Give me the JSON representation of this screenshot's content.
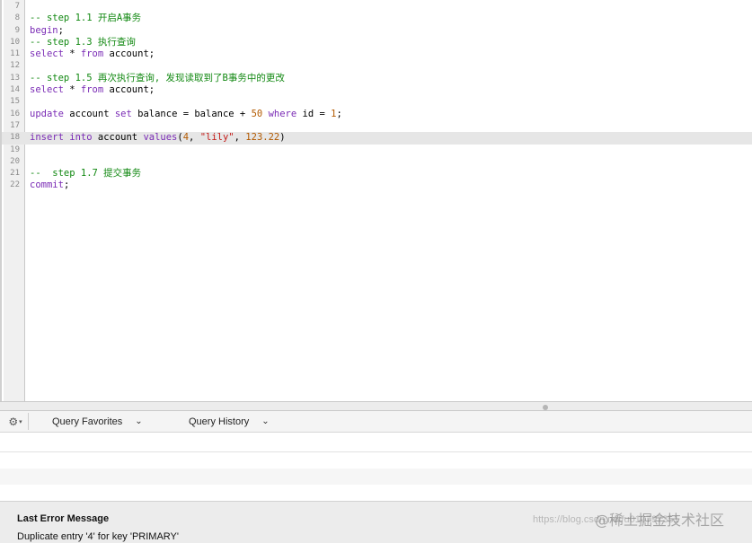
{
  "editor": {
    "lines": [
      {
        "n": "7",
        "text": ""
      },
      {
        "n": "8",
        "text": "-- step 1.1 开启A事务"
      },
      {
        "n": "9",
        "text": "begin;"
      },
      {
        "n": "10",
        "text": "-- step 1.3 执行查询"
      },
      {
        "n": "11",
        "text": "select * from account;"
      },
      {
        "n": "12",
        "text": ""
      },
      {
        "n": "13",
        "text": "-- step 1.5 再次执行查询, 发现读取到了B事务中的更改"
      },
      {
        "n": "14",
        "text": "select * from account;"
      },
      {
        "n": "15",
        "text": ""
      },
      {
        "n": "16",
        "text": "update account set balance = balance + 50 where id = 1;"
      },
      {
        "n": "17",
        "text": ""
      },
      {
        "n": "18",
        "text": "insert into account values(4, \"lily\", 123.22)"
      },
      {
        "n": "19",
        "text": ""
      },
      {
        "n": "20",
        "text": ""
      },
      {
        "n": "21",
        "text": "--  step 1.7 提交事务"
      },
      {
        "n": "22",
        "text": "commit;"
      }
    ],
    "highlighted_line": "18"
  },
  "toolbar": {
    "gear_icon": "⚙",
    "query_favorites": "Query Favorites",
    "query_history": "Query History"
  },
  "status": {
    "title": "Last Error Message",
    "message": "Duplicate entry '4' for key 'PRIMARY'"
  },
  "watermark": {
    "url": "https://blog.csdn.net/u010797351",
    "brand": "@稀土掘金技术社区"
  }
}
